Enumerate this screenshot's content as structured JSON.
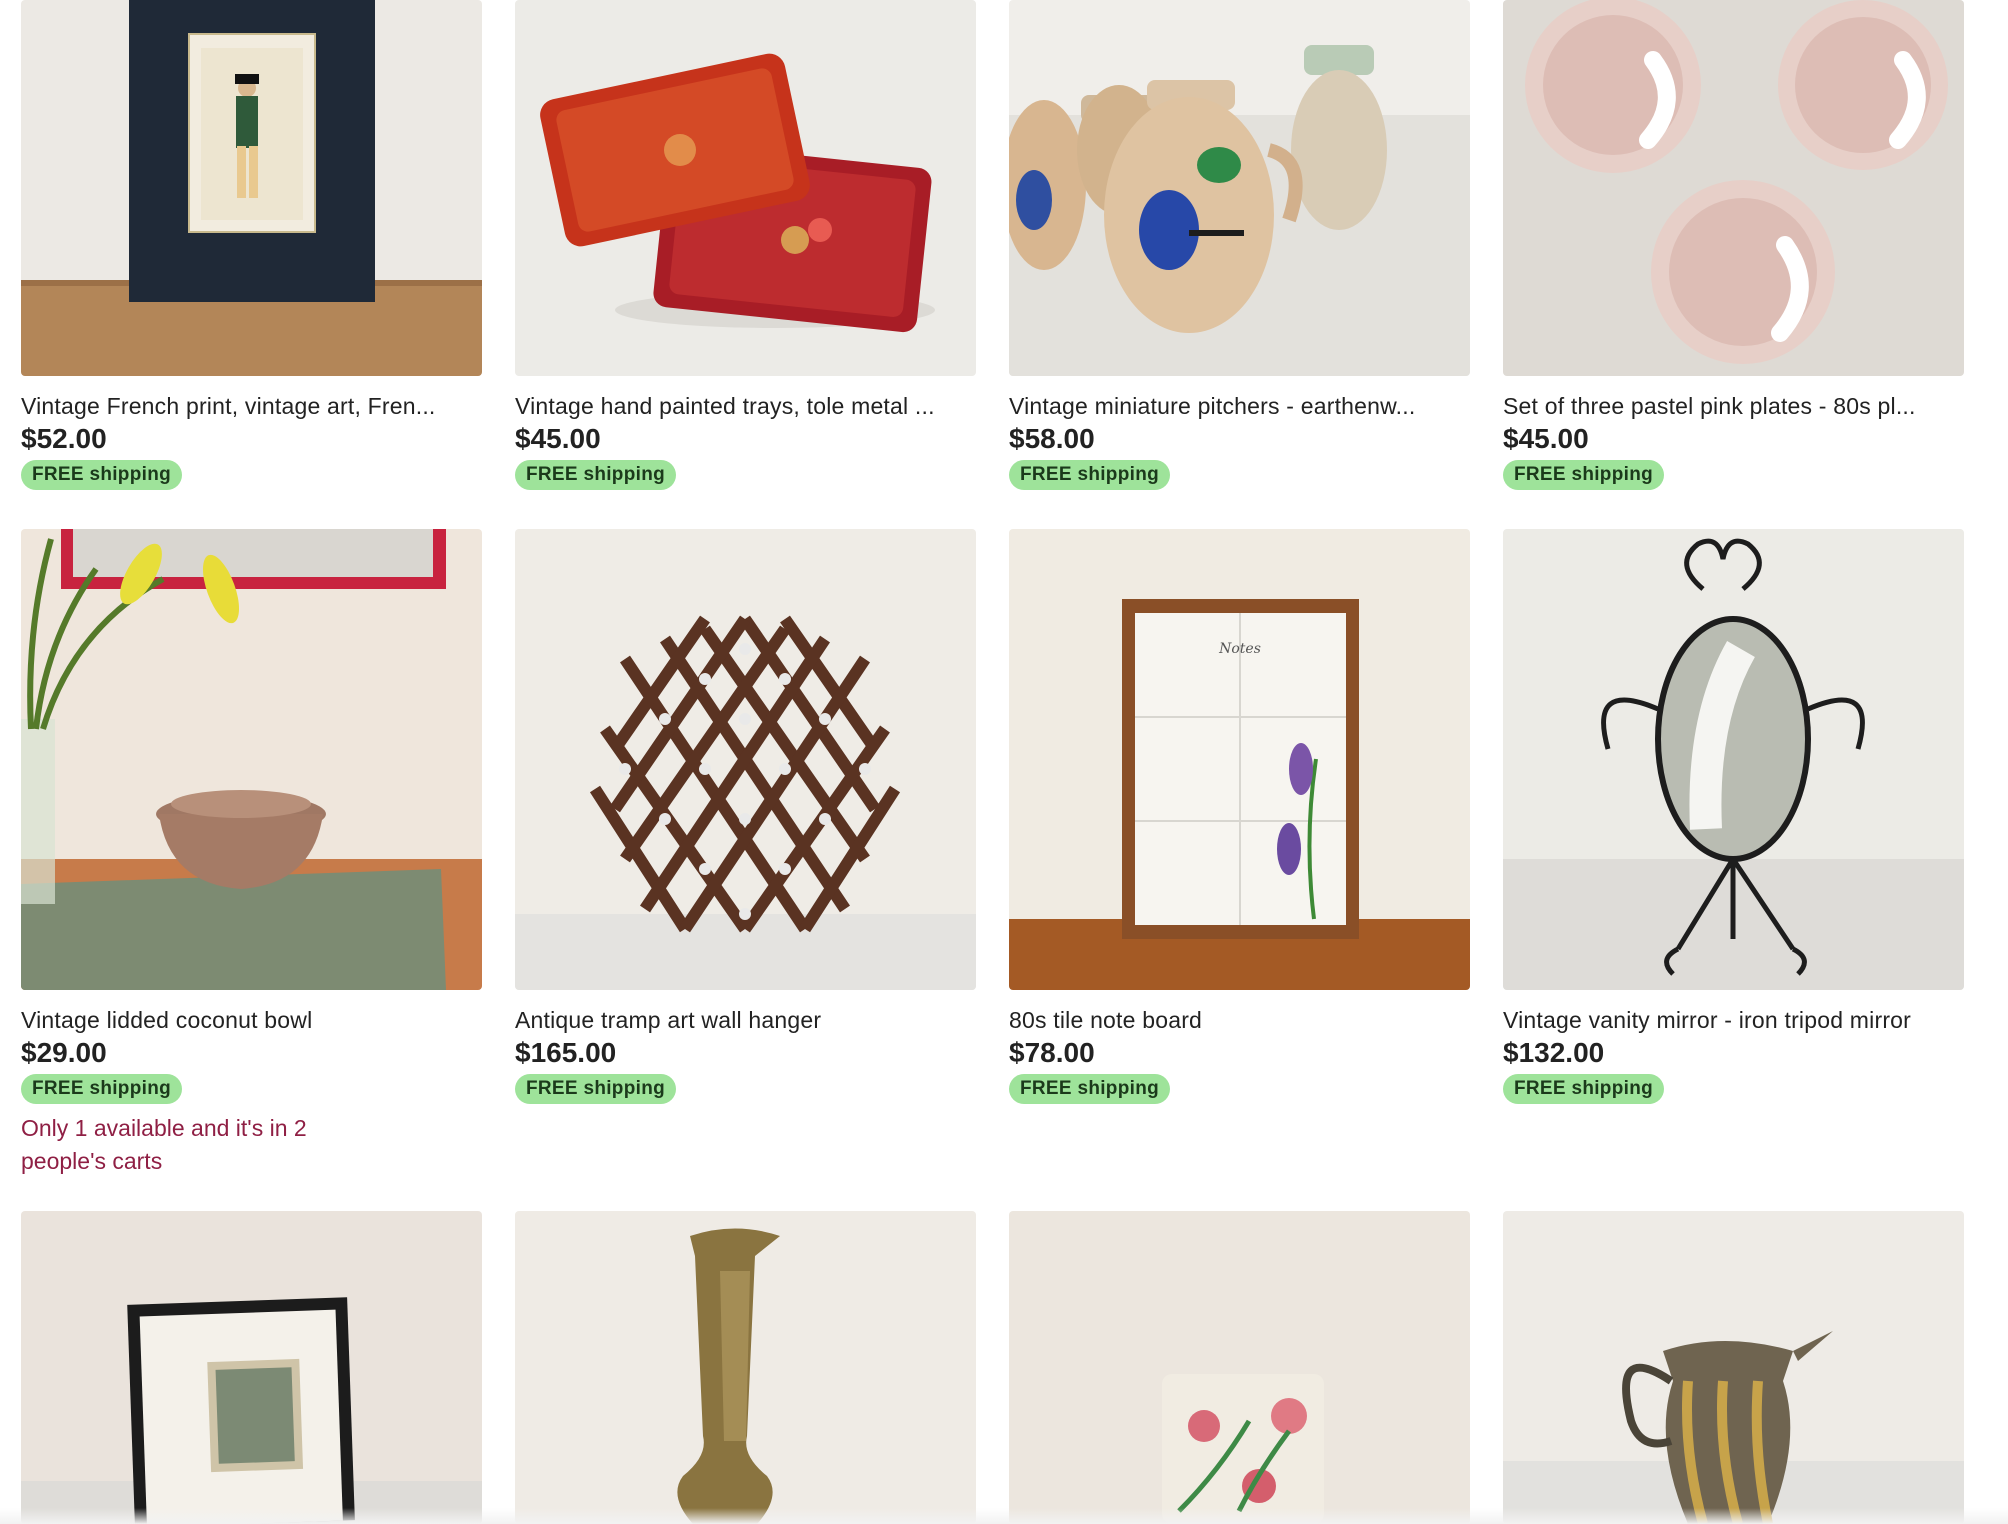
{
  "listings": [
    {
      "title": "Vintage French print, vintage art, Fren...",
      "price": "$52.00",
      "shipping": "FREE shipping",
      "image": "french-print-photo"
    },
    {
      "title": "Vintage hand painted trays, tole metal ...",
      "price": "$45.00",
      "shipping": "FREE shipping",
      "image": "painted-trays-photo"
    },
    {
      "title": "Vintage miniature pitchers - earthenw...",
      "price": "$58.00",
      "shipping": "FREE shipping",
      "image": "pitchers-photo"
    },
    {
      "title": "Set of three pastel pink plates - 80s pl...",
      "price": "$45.00",
      "shipping": "FREE shipping",
      "image": "pink-plates-photo"
    },
    {
      "title": "Vintage lidded coconut bowl",
      "price": "$29.00",
      "shipping": "FREE shipping",
      "scarcity": "Only 1 available and it's in 2 people's carts",
      "image": "coconut-bowl-photo"
    },
    {
      "title": "Antique tramp art wall hanger",
      "price": "$165.00",
      "shipping": "FREE shipping",
      "image": "tramp-art-photo"
    },
    {
      "title": "80s tile note board",
      "price": "$78.00",
      "shipping": "FREE shipping",
      "image": "tile-board-photo"
    },
    {
      "title": "Vintage vanity mirror - iron tripod mirror",
      "price": "$132.00",
      "shipping": "FREE shipping",
      "image": "vanity-mirror-photo"
    },
    {
      "image": "framed-etching-photo"
    },
    {
      "image": "brass-vase-photo"
    },
    {
      "image": "floral-box-photo"
    },
    {
      "image": "metal-pitcher-photo"
    }
  ],
  "tile_note_text": "Notes",
  "colors": {
    "badge_bg": "#9ee39a",
    "scarcity_text": "#8f1f44",
    "text": "#222222"
  }
}
